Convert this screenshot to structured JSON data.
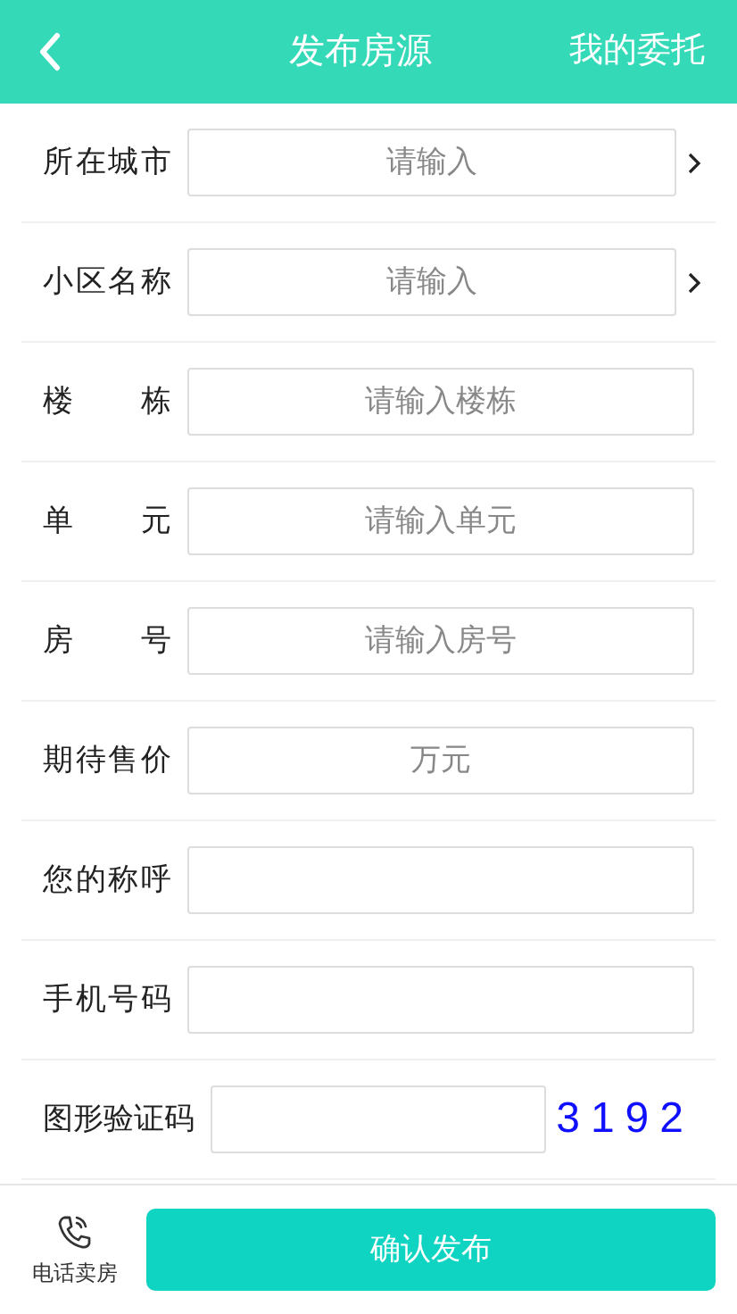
{
  "header": {
    "title": "发布房源",
    "right_link": "我的委托"
  },
  "fields": [
    {
      "kind": "select",
      "label": "所在城市",
      "placeholder": "请输入"
    },
    {
      "kind": "select",
      "label": "小区名称",
      "placeholder": "请输入"
    },
    {
      "kind": "text",
      "label": "楼栋",
      "placeholder": "请输入楼栋"
    },
    {
      "kind": "text",
      "label": "单元",
      "placeholder": "请输入单元"
    },
    {
      "kind": "text",
      "label": "房号",
      "placeholder": "请输入房号"
    },
    {
      "kind": "text",
      "label": "期待售价",
      "placeholder": "万元"
    },
    {
      "kind": "text",
      "label": "您的称呼"
    },
    {
      "kind": "text",
      "label": "手机号码"
    },
    {
      "kind": "captcha",
      "label": "图形验证码",
      "code": "3192"
    }
  ],
  "bottom_bar": {
    "phone_label": "电话卖房",
    "submit": "确认发布"
  }
}
